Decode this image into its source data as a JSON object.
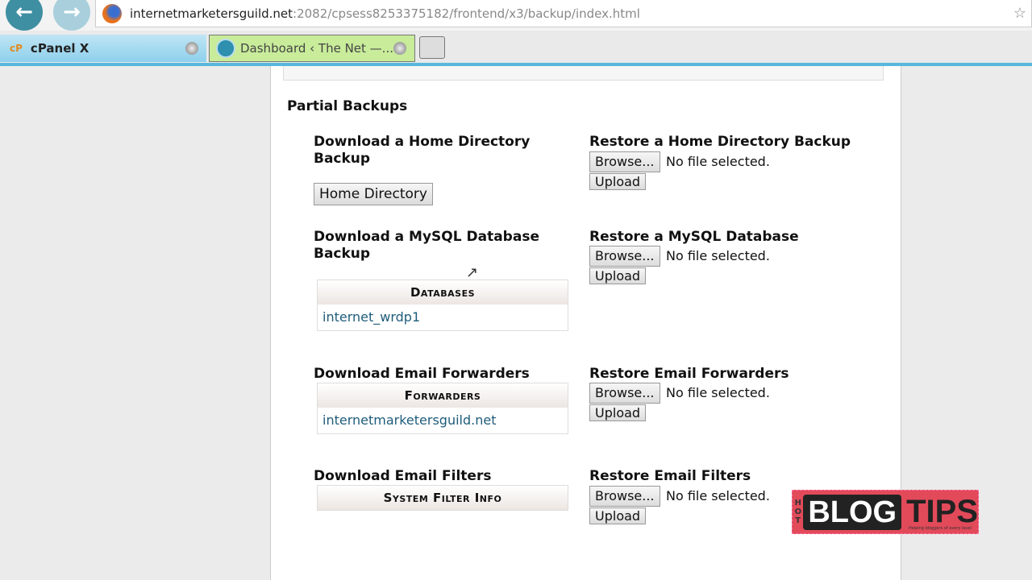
{
  "browser": {
    "url_host": "internetmarketersguild.net",
    "url_path": ":2082/cpsess8253375182/frontend/x3/backup/index.html",
    "tabs": [
      {
        "label": "cPanel X",
        "icon": "cP"
      },
      {
        "label": "Dashboard ‹ The Net —..."
      }
    ]
  },
  "section_title": "Partial Backups",
  "rows": [
    {
      "download_title": "Download a Home Directory Backup",
      "download_button": "Home Directory",
      "restore_title": "Restore a Home Directory Backup"
    },
    {
      "download_title": "Download a MySQL Database Backup",
      "table_header": "Databases",
      "table_item": "internet_wrdp1",
      "restore_title": "Restore a MySQL Database"
    },
    {
      "download_title": "Download Email Forwarders",
      "table_header": "Forwarders",
      "table_item": "internetmarketersguild.net",
      "restore_title": "Restore Email Forwarders"
    },
    {
      "download_title": "Download Email Filters",
      "table_header": "System Filter Info",
      "restore_title": "Restore Email Filters"
    }
  ],
  "browse_label": "Browse...",
  "no_file": "No file selected.",
  "upload_label": "Upload",
  "watermark": {
    "hot": "HOT",
    "blog": "BLOG",
    "tips": "TIPS",
    "tagline": "Helping bloggers of every level"
  }
}
